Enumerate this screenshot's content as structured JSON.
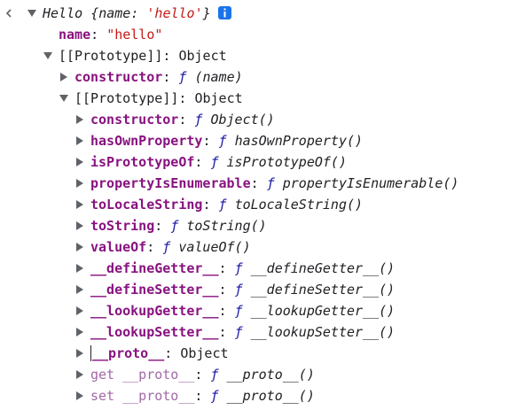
{
  "console": {
    "prompt_icon": "chevron-left-icon",
    "header": {
      "name": "Hello",
      "preview_open": "{",
      "preview_key": "name",
      "preview_colon": ": ",
      "preview_value": "'hello'",
      "preview_close": "}",
      "info_icon": "info-icon"
    },
    "name_prop": {
      "key": "name",
      "colon": ": ",
      "value": "\"hello\""
    },
    "proto1": {
      "label": "[[Prototype]]",
      "colon": ": ",
      "value": "Object"
    },
    "ctor1": {
      "key": "constructor",
      "colon": ": ",
      "f": "ƒ",
      "sig": "(name)"
    },
    "proto2": {
      "label": "[[Prototype]]",
      "colon": ": ",
      "value": "Object"
    },
    "members": [
      {
        "key": "constructor",
        "colon": ": ",
        "f": "ƒ",
        "sig": "Object()"
      },
      {
        "key": "hasOwnProperty",
        "colon": ": ",
        "f": "ƒ",
        "sig": "hasOwnProperty()"
      },
      {
        "key": "isPrototypeOf",
        "colon": ": ",
        "f": "ƒ",
        "sig": "isPrototypeOf()"
      },
      {
        "key": "propertyIsEnumerable",
        "colon": ": ",
        "f": "ƒ",
        "sig": "propertyIsEnumerable()"
      },
      {
        "key": "toLocaleString",
        "colon": ": ",
        "f": "ƒ",
        "sig": "toLocaleString()"
      },
      {
        "key": "toString",
        "colon": ": ",
        "f": "ƒ",
        "sig": "toString()"
      },
      {
        "key": "valueOf",
        "colon": ": ",
        "f": "ƒ",
        "sig": "valueOf()"
      },
      {
        "key": "__defineGetter__",
        "colon": ": ",
        "f": "ƒ",
        "sig": "__defineGetter__()"
      },
      {
        "key": "__defineSetter__",
        "colon": ": ",
        "f": "ƒ",
        "sig": "__defineSetter__()"
      },
      {
        "key": "__lookupGetter__",
        "colon": ": ",
        "f": "ƒ",
        "sig": "__lookupGetter__()"
      },
      {
        "key": "__lookupSetter__",
        "colon": ": ",
        "f": "ƒ",
        "sig": "__lookupSetter__()"
      }
    ],
    "proto_accessor": {
      "key": "__proto__",
      "colon": ": ",
      "value": "Object"
    },
    "getter": {
      "prefix": "get",
      "key": "__proto__",
      "colon": ": ",
      "f": "ƒ",
      "sig": "__proto__()"
    },
    "setter": {
      "prefix": "set",
      "key": "__proto__",
      "colon": ": ",
      "f": "ƒ",
      "sig": "__proto__()"
    }
  },
  "colors": {
    "key": "#881280",
    "key_dim": "#a368a8",
    "string": "#c41a16",
    "function": "#1a1aa6",
    "text": "#202124",
    "info_badge": "#1a73e8",
    "triangle": "#5f6368"
  }
}
